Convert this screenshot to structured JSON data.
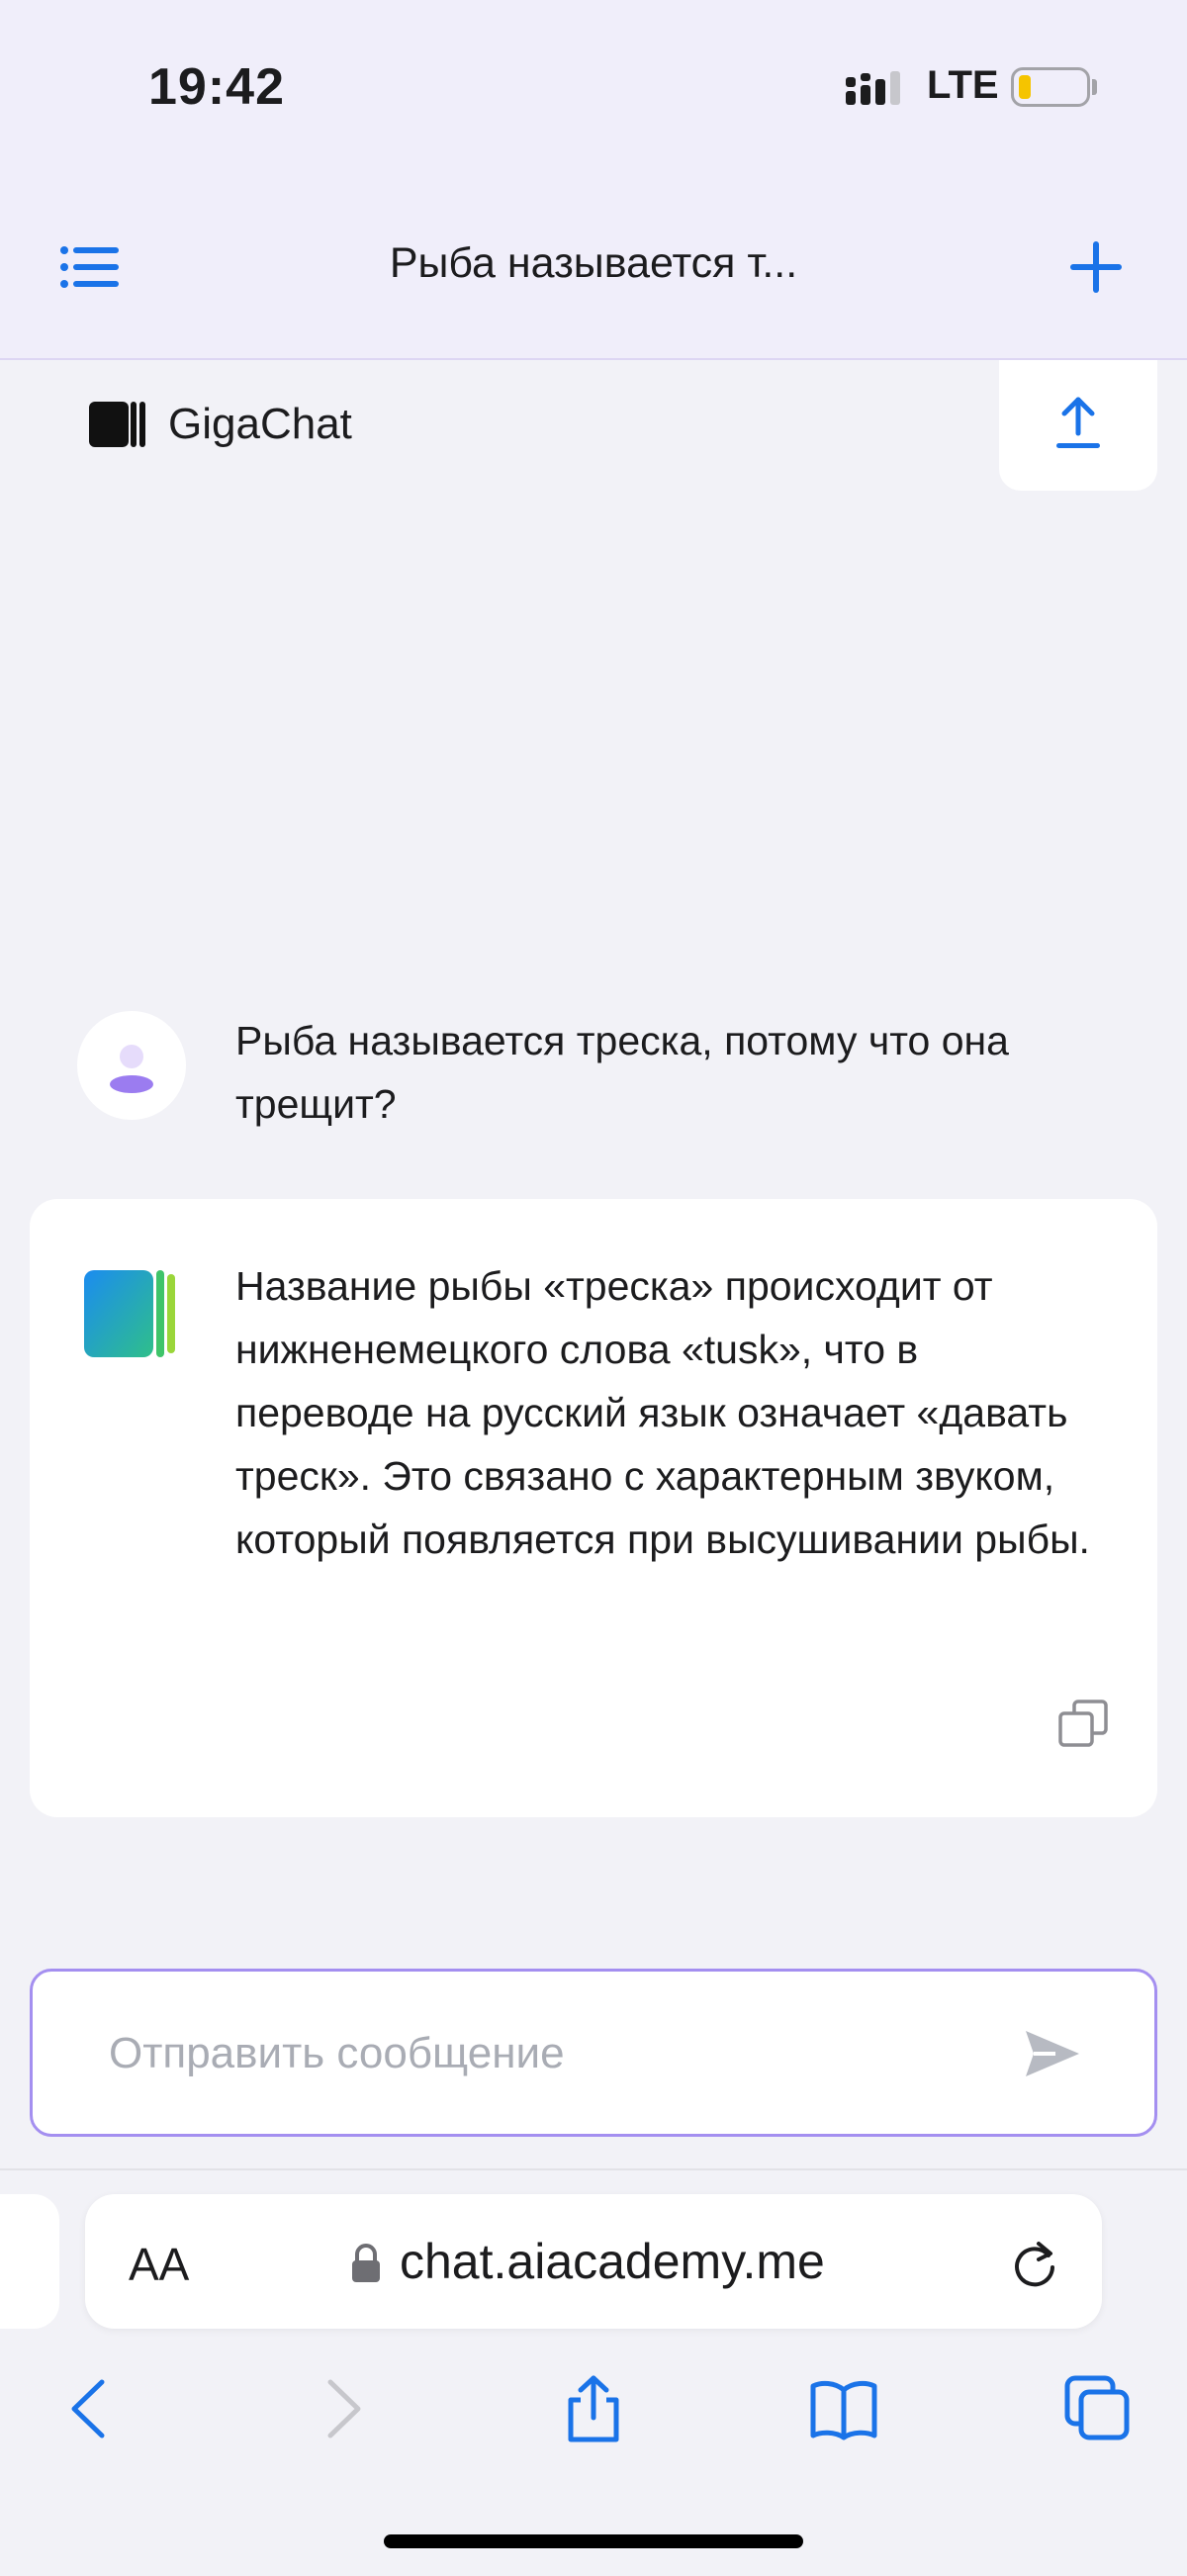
{
  "status_bar": {
    "time": "19:42",
    "network": "LTE"
  },
  "header": {
    "title": "Рыба называется т..."
  },
  "brand": {
    "name": "GigaChat"
  },
  "chat": {
    "user_message": "Рыба называется треска, потому что она трещит?",
    "bot_message": "Название рыбы «треска» происходит от нижненемецкого слова «tusk», что в переводе на русский язык означает «давать треск». Это связано с характерным звуком, который появляется при высушивании рыбы."
  },
  "composer": {
    "placeholder": "Отправить сообщение"
  },
  "browser": {
    "text_size_label": "AA",
    "url": "chat.aiacademy.me"
  },
  "colors": {
    "accent": "#1a73e8",
    "input_border": "#a48ff0",
    "header_bg": "#f0eefa"
  }
}
